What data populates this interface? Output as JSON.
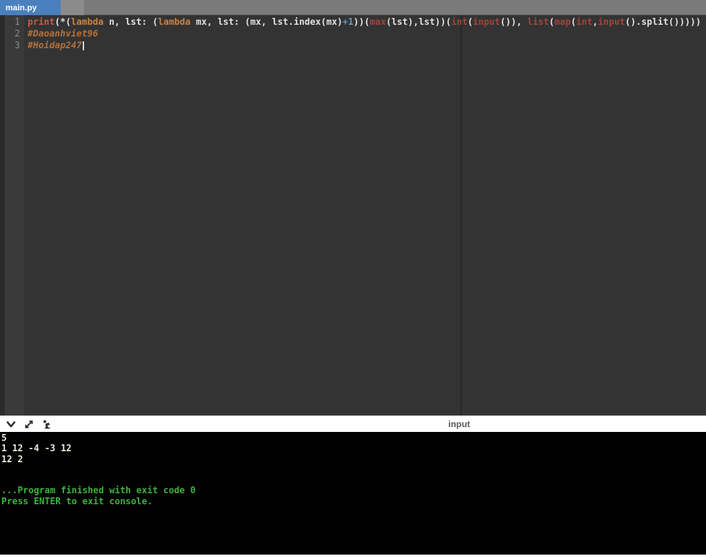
{
  "tab_bar": {
    "active_tab": "main.py"
  },
  "editor": {
    "cursor_line": 3,
    "lines": [
      {
        "number": "1",
        "tokens": [
          {
            "text": "print",
            "type": "fn"
          },
          {
            "text": "(*(",
            "type": "plain"
          },
          {
            "text": "lambda",
            "type": "kw"
          },
          {
            "text": " n, lst: (",
            "type": "plain"
          },
          {
            "text": "lambda",
            "type": "kw"
          },
          {
            "text": " mx, lst: (mx, lst.index(mx)",
            "type": "plain"
          },
          {
            "text": "+1",
            "type": "num"
          },
          {
            "text": "))(",
            "type": "plain"
          },
          {
            "text": "max",
            "type": "builtin"
          },
          {
            "text": "(lst),lst))(",
            "type": "plain"
          },
          {
            "text": "int",
            "type": "builtin"
          },
          {
            "text": "(",
            "type": "plain"
          },
          {
            "text": "input",
            "type": "builtin"
          },
          {
            "text": "()), ",
            "type": "plain"
          },
          {
            "text": "list",
            "type": "builtin"
          },
          {
            "text": "(",
            "type": "plain"
          },
          {
            "text": "map",
            "type": "builtin"
          },
          {
            "text": "(",
            "type": "plain"
          },
          {
            "text": "int",
            "type": "builtin"
          },
          {
            "text": ",",
            "type": "plain"
          },
          {
            "text": "input",
            "type": "builtin"
          },
          {
            "text": "().split()))))",
            "type": "plain"
          }
        ]
      },
      {
        "number": "2",
        "tokens": [
          {
            "text": "#Daoanhviet96",
            "type": "comment"
          }
        ]
      },
      {
        "number": "3",
        "tokens": [
          {
            "text": "#Hoidap247",
            "type": "comment"
          }
        ]
      }
    ]
  },
  "console": {
    "header": {
      "label": "input",
      "icons": [
        "chevron-down-icon",
        "expand-icon",
        "share-icon"
      ]
    },
    "lines": [
      {
        "text": "5",
        "color": "default"
      },
      {
        "text": "1 12 -4 -3 12",
        "color": "default"
      },
      {
        "text": "12 2",
        "color": "default"
      },
      {
        "text": "",
        "color": "default"
      },
      {
        "text": "",
        "color": "default"
      },
      {
        "text": "...Program finished with exit code 0",
        "color": "green"
      },
      {
        "text": "Press ENTER to exit console.",
        "color": "green"
      }
    ]
  },
  "colors": {
    "tab_active_bg": "#4a80bd",
    "tab_bar_bg": "#7a7a7a",
    "editor_bg": "#333333",
    "gutter_bg": "#3a3a3a",
    "console_bg": "#000000",
    "console_text": "#e8e8da",
    "console_success_green": "#3cb43c",
    "syntax_print": "#c75b49",
    "syntax_keyword": "#cc8242",
    "syntax_builtin": "#a0453b",
    "syntax_number": "#6897bb",
    "syntax_comment": "#b5713a",
    "syntax_plain": "#e2e2e2"
  }
}
